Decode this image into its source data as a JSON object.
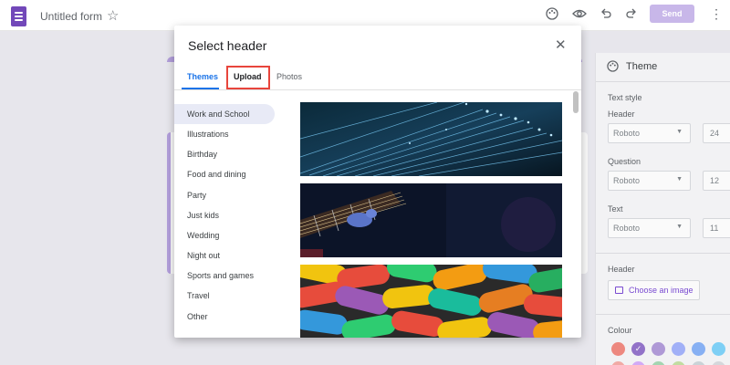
{
  "app": {
    "form_title": "Untitled form",
    "send_label": "Send",
    "icons": [
      "forms-doc-icon",
      "star-icon",
      "palette-icon",
      "eye-icon",
      "undo-icon",
      "redo-icon",
      "more-vert-icon"
    ]
  },
  "dialog": {
    "title": "Select header",
    "close_icon": "close-icon",
    "tabs": [
      {
        "label": "Themes",
        "active": true
      },
      {
        "label": "Upload",
        "active": false,
        "highlighted": true
      },
      {
        "label": "Photos",
        "active": false
      }
    ],
    "categories": [
      {
        "label": "Work and School",
        "active": true
      },
      {
        "label": "Illustrations"
      },
      {
        "label": "Birthday"
      },
      {
        "label": "Food and dining"
      },
      {
        "label": "Party"
      },
      {
        "label": "Just kids"
      },
      {
        "label": "Wedding"
      },
      {
        "label": "Night out"
      },
      {
        "label": "Sports and games"
      },
      {
        "label": "Travel"
      },
      {
        "label": "Other"
      }
    ],
    "images": [
      "fiber-optic-header-image",
      "guitar-header-image",
      "candy-header-image"
    ]
  },
  "theme_panel": {
    "title": "Theme",
    "text_style_label": "Text style",
    "header_label": "Header",
    "header_font": "Roboto",
    "header_size": "24",
    "question_label": "Question",
    "question_font": "Roboto",
    "question_size": "12",
    "text_label": "Text",
    "text_font": "Roboto",
    "text_size": "11",
    "header_image_label": "Header",
    "choose_image_label": "Choose an image",
    "colour_label": "Colour",
    "colours": [
      "#f28b82",
      "#9575cd",
      "#b39ddb",
      "#a5b4fc",
      "#8ab4f8",
      "#81d4fa"
    ],
    "colours_row2": [
      "#f6aea9",
      "#d7aefb",
      "#a8dab5",
      "#c5e1a5",
      "#cfd8dc",
      "#dadce0"
    ],
    "selected_colour_index": 1
  }
}
